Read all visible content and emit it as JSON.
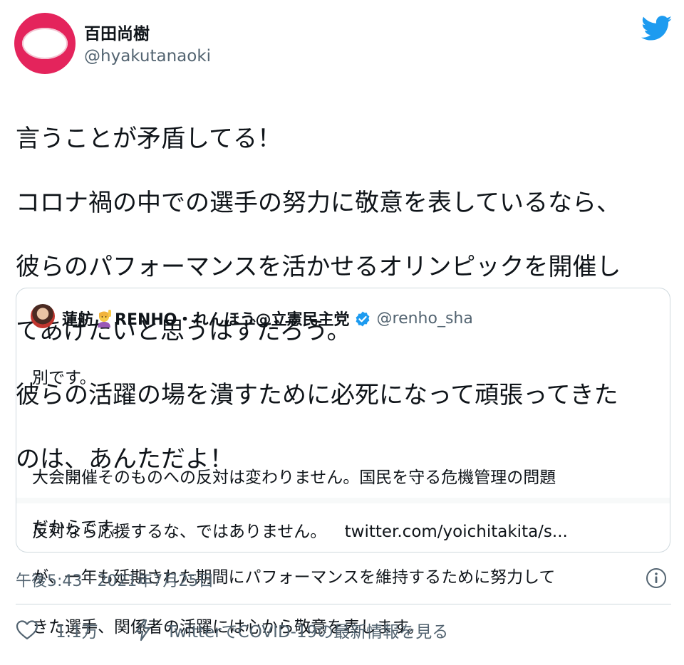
{
  "author": {
    "name": "百田尚樹",
    "handle": "@hyakutanaoki",
    "avatar_icon": "red-ring-avatar"
  },
  "tweet": {
    "lines": [
      "言うことが矛盾してる！",
      "コロナ禍の中での選手の努力に敬意を表しているなら、",
      "彼らのパフォーマンスを活かせるオリンピックを開催し",
      "てあげたいと思うはずだろう。",
      "彼らの活躍の場を潰すために必死になって頑張ってきた",
      "のは、あんただよ！"
    ]
  },
  "quote": {
    "name": "蓮舫",
    "emoji_icon": "person-raising-hand-emoji",
    "name_suffix": "RENHO・れんほう@立憲民主党",
    "verified_icon": "verified-badge-icon",
    "handle": "@renho_sha",
    "lines": [
      "別です。",
      "",
      "大会開催そのものへの反対は変わりません。国民を守る危機管理の問題",
      "だからです。",
      "が、一年も延期された期間にパフォーマンスを維持するために努力して",
      "きた選手、関係者の活躍には心から敬意を表します。"
    ],
    "last_line": "反対なら応援するな、ではありません。",
    "link": "twitter.com/yoichitakita/s..."
  },
  "meta": {
    "timestamp": "午後5:43 · 2021年7月25日"
  },
  "actions": {
    "like_count": "1.1万",
    "covid_link": "TwitterでCOVID-19の最新情報を見る"
  },
  "colors": {
    "brand_blue": "#1d9bf0",
    "avatar_red": "#e4245c",
    "secondary_text": "#536471",
    "border": "#cfd9de"
  }
}
